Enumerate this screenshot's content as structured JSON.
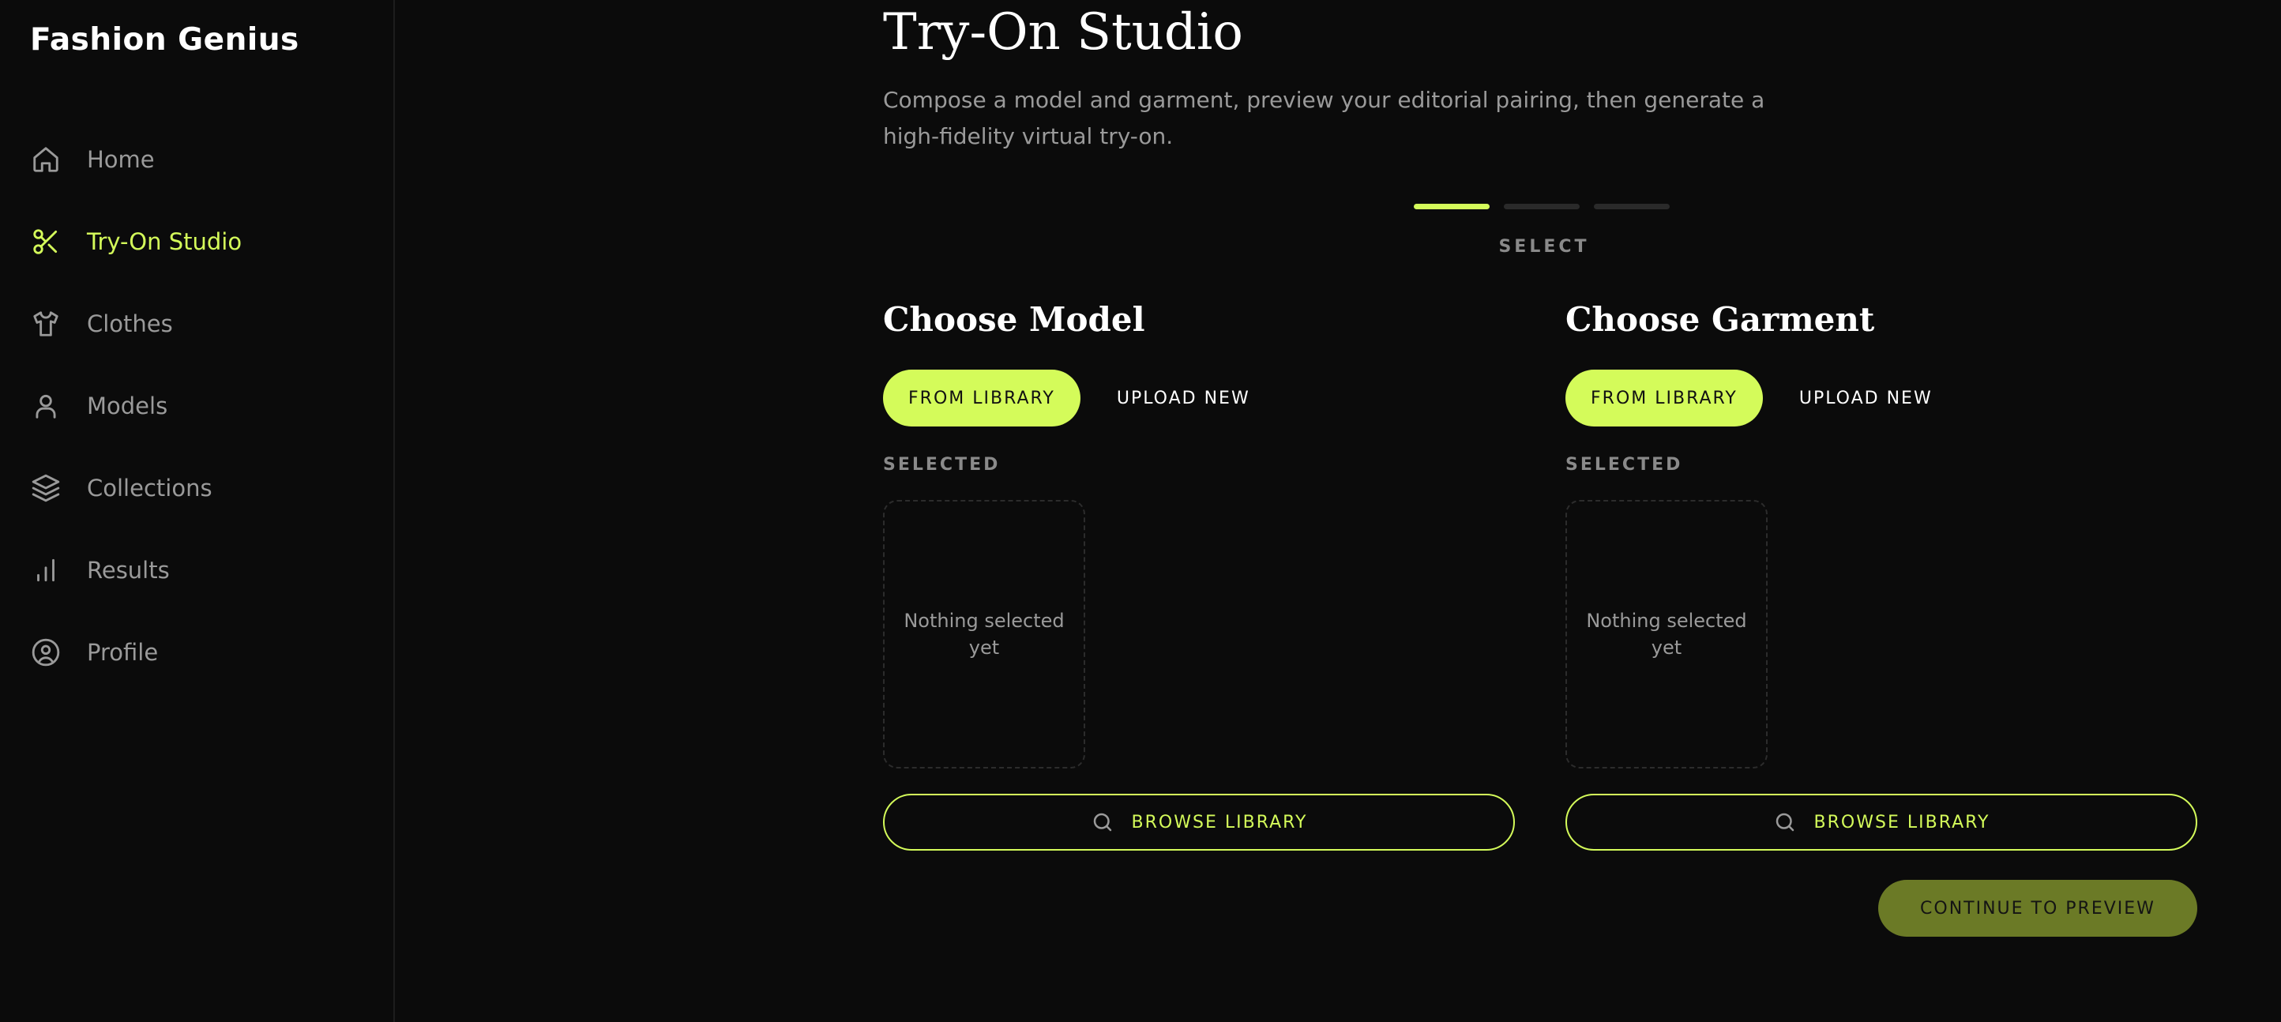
{
  "brand": "Fashion Genius",
  "sidebar": {
    "items": [
      {
        "label": "Home",
        "icon": "home-icon"
      },
      {
        "label": "Try-On Studio",
        "icon": "scissors-icon",
        "active": true
      },
      {
        "label": "Clothes",
        "icon": "shirt-icon"
      },
      {
        "label": "Models",
        "icon": "user-icon"
      },
      {
        "label": "Collections",
        "icon": "layers-icon"
      },
      {
        "label": "Results",
        "icon": "bar-chart-icon"
      },
      {
        "label": "Profile",
        "icon": "user-circle-icon"
      }
    ]
  },
  "header": {
    "title": "Try-On Studio",
    "subtitle": "Compose a model and garment, preview your editorial pairing, then generate a high-fidelity virtual try-on."
  },
  "steps": {
    "current_label": "SELECT",
    "current_index": 1,
    "total": 3
  },
  "model_panel": {
    "title": "Choose Model",
    "tab_library": "FROM LIBRARY",
    "tab_upload": "UPLOAD NEW",
    "selected_label": "SELECTED",
    "empty_text": "Nothing selected yet",
    "browse_label": "BROWSE LIBRARY"
  },
  "garment_panel": {
    "title": "Choose Garment",
    "tab_library": "FROM LIBRARY",
    "tab_upload": "UPLOAD NEW",
    "selected_label": "SELECTED",
    "empty_text": "Nothing selected yet",
    "browse_label": "BROWSE LIBRARY"
  },
  "continue_label": "CONTINUE TO PREVIEW",
  "colors": {
    "accent": "#d4fb5a",
    "background": "#0b0b0b",
    "muted_text": "#9a9a9a",
    "continue_disabled": "#6b7a26"
  }
}
